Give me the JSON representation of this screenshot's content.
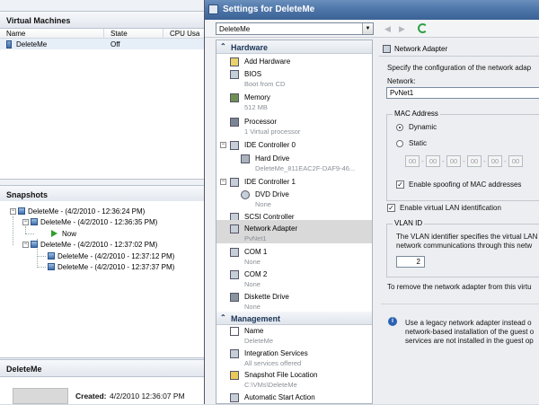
{
  "left": {
    "vm_panel_title": "Virtual Machines",
    "vm_columns": [
      "Name",
      "State",
      "CPU Usa"
    ],
    "vm_rows": [
      {
        "name": "DeleteMe",
        "state": "Off"
      }
    ],
    "snapshots_title": "Snapshots",
    "snapshots": [
      {
        "label": "DeleteMe - (4/2/2010 - 12:36:24 PM)"
      },
      {
        "label": "DeleteMe - (4/2/2010 - 12:36:35 PM)"
      },
      {
        "label": "Now"
      },
      {
        "label": "DeleteMe - (4/2/2010 - 12:37:02 PM)"
      },
      {
        "label": "DeleteMe - (4/2/2010 - 12:37:12 PM)"
      },
      {
        "label": "DeleteMe - (4/2/2010 - 12:37:37 PM)"
      }
    ],
    "detail_title": "DeleteMe",
    "created_label": "Created:",
    "created_value": "4/2/2010 12:36:07 PM"
  },
  "window": {
    "title": "Settings for DeleteMe",
    "vm_select": "DeleteMe",
    "nav_back": "◀",
    "nav_forward": "▶"
  },
  "tree": {
    "hardware_header": "Hardware",
    "management_header": "Management",
    "hardware_items": [
      {
        "label": "Add Hardware",
        "sub": ""
      },
      {
        "label": "BIOS",
        "sub": "Boot from CD"
      },
      {
        "label": "Memory",
        "sub": "512 MB"
      },
      {
        "label": "Processor",
        "sub": "1 Virtual processor"
      },
      {
        "label": "IDE Controller 0",
        "sub": ""
      },
      {
        "label": "Hard Drive",
        "sub": "DeleteMe_811EAC2F-DAF9-46..."
      },
      {
        "label": "IDE Controller 1",
        "sub": ""
      },
      {
        "label": "DVD Drive",
        "sub": "None"
      },
      {
        "label": "SCSI Controller",
        "sub": ""
      },
      {
        "label": "Network Adapter",
        "sub": "PvNet1"
      },
      {
        "label": "COM 1",
        "sub": "None"
      },
      {
        "label": "COM 2",
        "sub": "None"
      },
      {
        "label": "Diskette Drive",
        "sub": "None"
      }
    ],
    "management_items": [
      {
        "label": "Name",
        "sub": "DeleteMe"
      },
      {
        "label": "Integration Services",
        "sub": "All services offered"
      },
      {
        "label": "Snapshot File Location",
        "sub": "C:\\VMs\\DeleteMe"
      },
      {
        "label": "Automatic Start Action",
        "sub": ""
      }
    ]
  },
  "content": {
    "heading": "Network Adapter",
    "description": "Specify the configuration of the network adap",
    "network_label": "Network:",
    "network_value": "PvNet1",
    "mac_group": "MAC Address",
    "dynamic_label": "Dynamic",
    "static_label": "Static",
    "mac_octets": [
      "00",
      "00",
      "00",
      "00",
      "00",
      "00"
    ],
    "spoofing_label": "Enable spoofing of MAC addresses",
    "vlan_check_label": "Enable virtual LAN identification",
    "vlan_group": "VLAN ID",
    "vlan_desc_1": "The VLAN identifier specifies the virtual LAN",
    "vlan_desc_2": "network communications through this netw",
    "vlan_value": "2",
    "remove_text": "To remove the network adapter from this virtu",
    "info_1": "Use a legacy network adapter instead o",
    "info_2": "network-based installation of the guest o",
    "info_3": "services are not installed in the guest op"
  }
}
